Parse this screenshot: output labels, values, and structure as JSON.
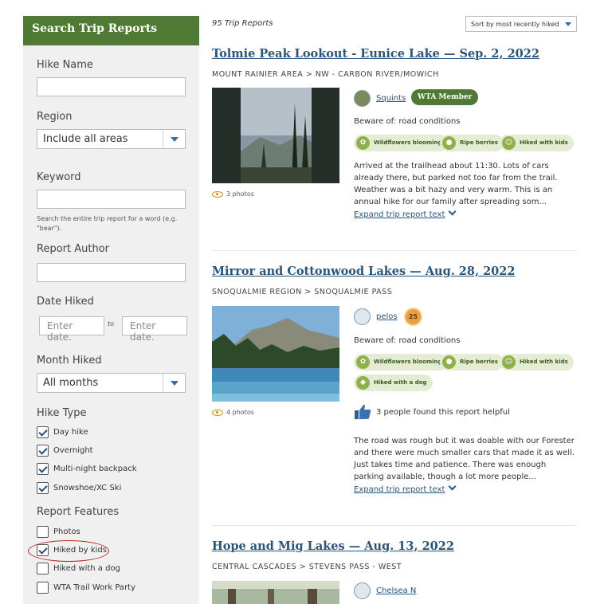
{
  "sidebar": {
    "title": "Search Trip Reports",
    "hike_name_label": "Hike Name",
    "region_label": "Region",
    "region_value": "Include all areas",
    "keyword_label": "Keyword",
    "keyword_help": "Search the entire trip report for a word (e.g. \"bear\").",
    "author_label": "Report Author",
    "date_label": "Date Hiked",
    "date_from_placeholder": "Enter date.",
    "date_to_label": "to",
    "date_to_placeholder": "Enter date.",
    "month_label": "Month Hiked",
    "month_value": "All months",
    "hike_type_label": "Hike Type",
    "hike_types": [
      {
        "label": "Day hike",
        "checked": true
      },
      {
        "label": "Overnight",
        "checked": true
      },
      {
        "label": "Multi-night backpack",
        "checked": true
      },
      {
        "label": "Snowshoe/XC Ski",
        "checked": true
      }
    ],
    "features_label": "Report Features",
    "features": [
      {
        "label": "Photos",
        "checked": false
      },
      {
        "label": "Hiked by kids",
        "checked": true
      },
      {
        "label": "Hiked with a dog",
        "checked": false
      },
      {
        "label": "WTA Trail Work Party",
        "checked": false
      }
    ]
  },
  "results": {
    "count": "95 Trip Reports",
    "sort_value": "Sort by most recently hiked"
  },
  "reports": [
    {
      "title": "Tolmie Peak Lookout - Eunice Lake — Sep. 2, 2022",
      "region": "MOUNT RAINIER AREA > NW - CARBON RIVER/MOWICH",
      "photos": "3 photos",
      "author": "Squints",
      "badge": "WTA Member",
      "beware": "Beware of: road conditions",
      "tags": [
        "Wildflowers blooming",
        "Ripe berries",
        "Hiked with kids"
      ],
      "text": "Arrived at the trailhead about 11:30. Lots of cars already there, but parked not too far from the trail. Weather was a bit hazy and very warm. This is an annual hike for our family after spreading som...",
      "expand": "Expand trip report text"
    },
    {
      "title": "Mirror and Cottonwood Lakes — Aug. 28, 2022",
      "region": "SNOQUALMIE REGION > SNOQUALMIE PASS",
      "photos": "4 photos",
      "author": "pelos",
      "medal": "25",
      "beware": "Beware of: road conditions",
      "tags": [
        "Wildflowers blooming",
        "Ripe berries",
        "Hiked with kids",
        "Hiked with a dog"
      ],
      "helpful": "3 people found this report helpful",
      "text": "The road was rough but it was doable with our Forester and there were much smaller cars that made it as well. Just takes time and patience. There was enough parking available, though a lot more people...",
      "expand": "Expand trip report text"
    },
    {
      "title": "Hope and Mig Lakes — Aug. 13, 2022",
      "region": "CENTRAL CASCADES > STEVENS PASS - WEST",
      "author": "Chelsea N"
    }
  ]
}
